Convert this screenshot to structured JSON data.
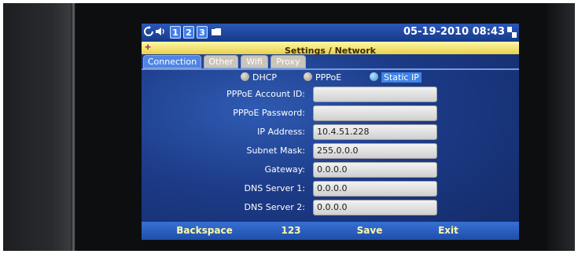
{
  "status_bar": {
    "line_numbers": [
      "1",
      "2",
      "3"
    ],
    "datetime": "05-19-2010 08:43"
  },
  "title": "Settings / Network",
  "tabs": [
    {
      "label": "Connection",
      "active": true
    },
    {
      "label": "Other",
      "active": false
    },
    {
      "label": "Wifi",
      "active": false
    },
    {
      "label": "Proxy",
      "active": false
    }
  ],
  "connection_type": {
    "options": [
      "DHCP",
      "PPPoE",
      "Static IP"
    ],
    "selected": "Static IP"
  },
  "fields": [
    {
      "label": "PPPoE Account ID:",
      "value": ""
    },
    {
      "label": "PPPoE Password:",
      "value": ""
    },
    {
      "label": "IP Address:",
      "value": "10.4.51.228"
    },
    {
      "label": "Subnet Mask:",
      "value": "255.0.0.0"
    },
    {
      "label": "Gateway:",
      "value": "0.0.0.0"
    },
    {
      "label": "DNS Server 1:",
      "value": "0.0.0.0"
    },
    {
      "label": "DNS Server 2:",
      "value": "0.0.0.0"
    }
  ],
  "softkeys": [
    "Backspace",
    "123",
    "Save",
    "Exit"
  ],
  "colors": {
    "screen_bg": "#1c3a86",
    "title_bar": "#e9d04a",
    "softkey_text": "#fff9a8",
    "active_tab": "#4f86e6",
    "inactive_tab": "#c9c5bb"
  }
}
